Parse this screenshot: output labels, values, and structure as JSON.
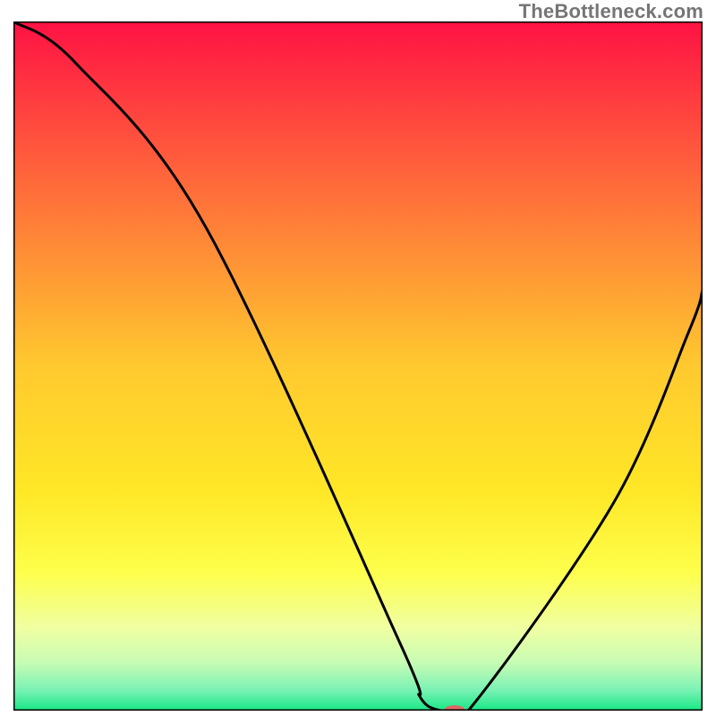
{
  "watermark": {
    "text": "TheBottleneck.com"
  },
  "chart_data": {
    "type": "line",
    "title": "",
    "xlabel": "",
    "ylabel": "",
    "xlim": [
      0,
      100
    ],
    "ylim": [
      0,
      100
    ],
    "grid": false,
    "legend": false,
    "background_gradient": {
      "stops": [
        {
          "offset": 0.0,
          "color": "#ff1244"
        },
        {
          "offset": 0.25,
          "color": "#ff6f3a"
        },
        {
          "offset": 0.5,
          "color": "#ffc92f"
        },
        {
          "offset": 0.68,
          "color": "#ffe726"
        },
        {
          "offset": 0.8,
          "color": "#fdff4c"
        },
        {
          "offset": 0.88,
          "color": "#f0ffa2"
        },
        {
          "offset": 0.93,
          "color": "#c8fcb4"
        },
        {
          "offset": 0.97,
          "color": "#7af2b4"
        },
        {
          "offset": 1.0,
          "color": "#17e886"
        }
      ]
    },
    "series": [
      {
        "name": "bottleneck-curve",
        "color": "#000000",
        "x": [
          0,
          9,
          28,
          56,
          59,
          62,
          66,
          87,
          98,
          100
        ],
        "values": [
          100,
          94,
          70,
          10,
          2,
          0,
          0,
          30,
          55,
          61
        ]
      }
    ],
    "marker": {
      "name": "current-point",
      "x": 64,
      "y": 0,
      "color": "#e06666",
      "rx": 12,
      "ry": 6
    },
    "frame": {
      "color": "#000000",
      "width": 3
    }
  }
}
